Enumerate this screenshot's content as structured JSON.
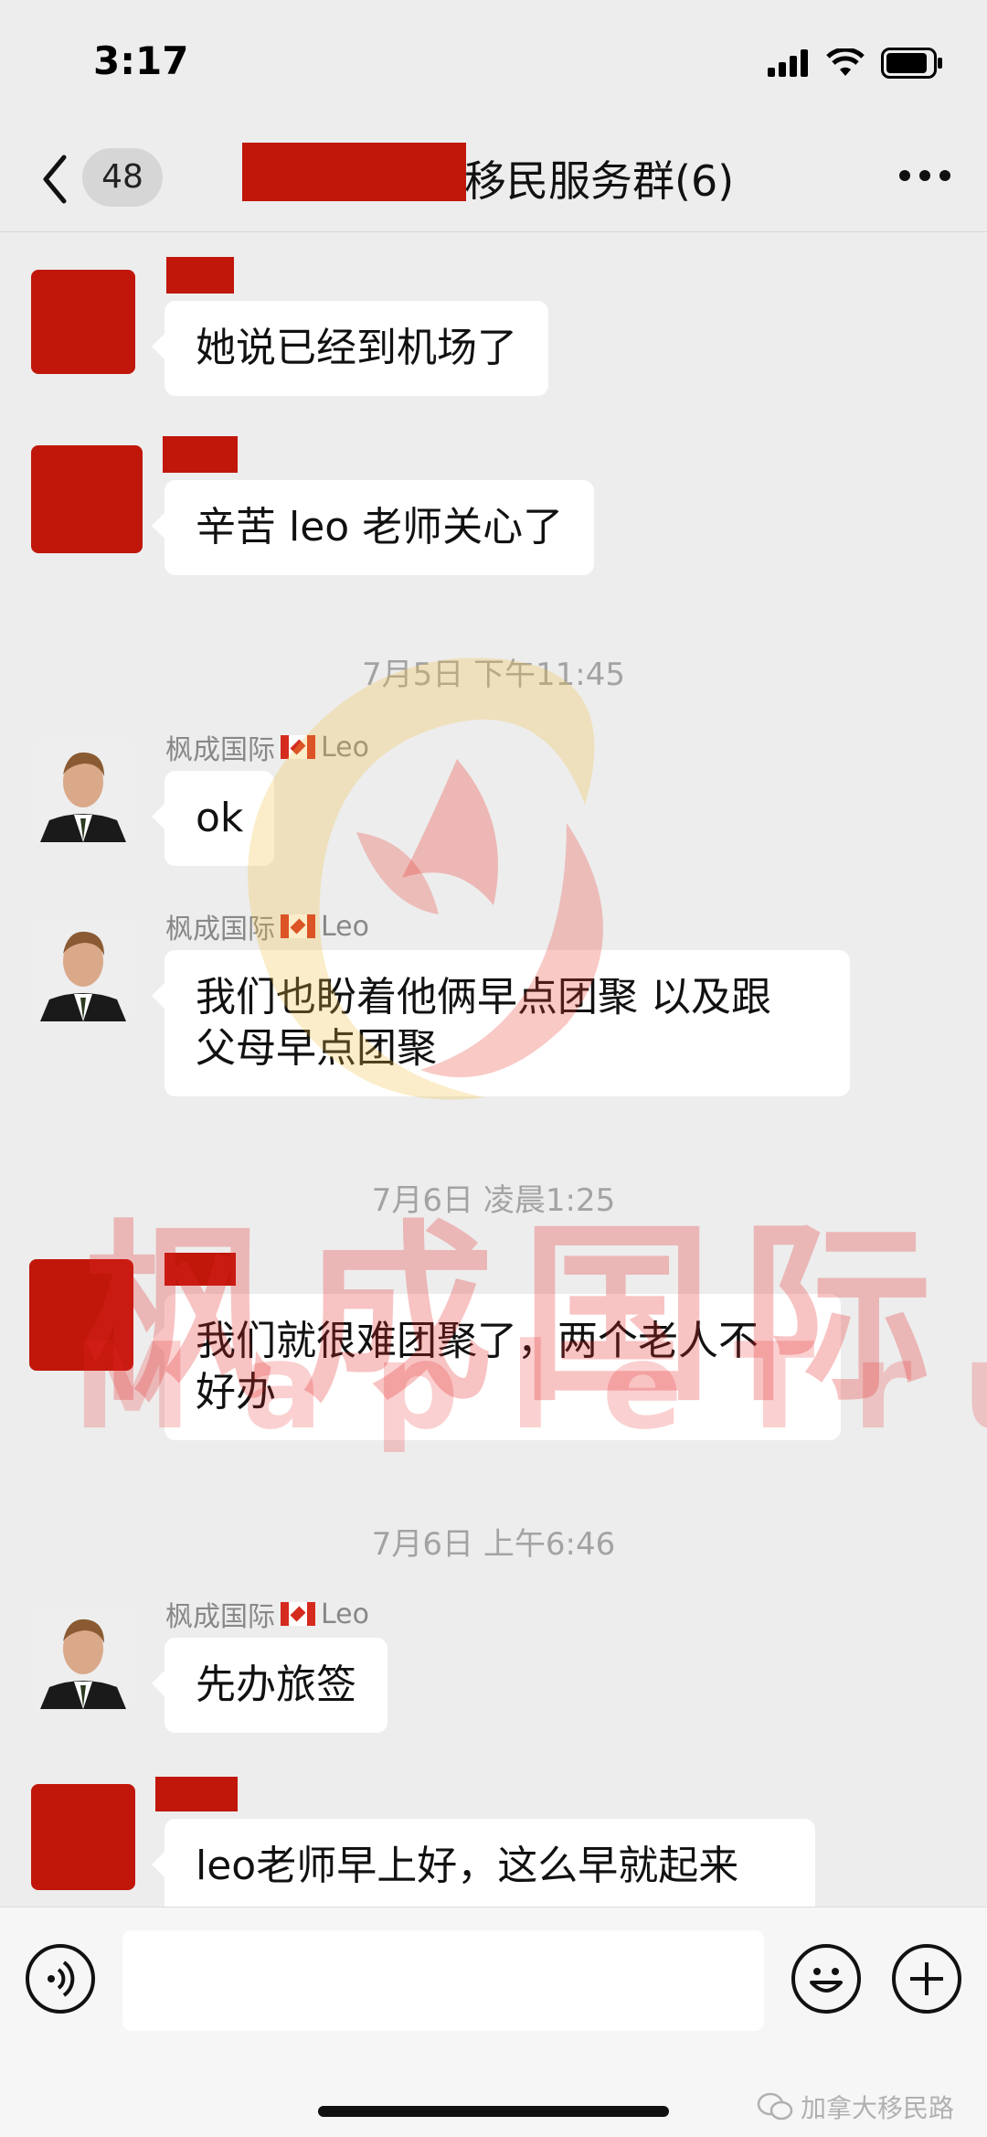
{
  "status_bar": {
    "time": "3:17",
    "battery_level": 0.8
  },
  "nav": {
    "unread_count": "48",
    "title": "移民服务群(6)"
  },
  "messages": [
    {
      "text": "她说已经到机场了"
    },
    {
      "text": "辛苦 leo 老师关心了"
    },
    {
      "timestamp": "7月5日 下午11:45"
    },
    {
      "sender": "枫成国际",
      "sender_suffix": "Leo",
      "text": "ok"
    },
    {
      "sender": "枫成国际",
      "sender_suffix": "Leo",
      "text_line1": "我们也盼着他俩早点团聚 以及跟",
      "text_line2": "父母早点团聚"
    },
    {
      "timestamp": "7月6日 凌晨1:25"
    },
    {
      "text_line1": "我们就很难团聚了，两个老人不",
      "text_line2": "好办"
    },
    {
      "timestamp": "7月6日 上午6:46"
    },
    {
      "sender": "枫成国际",
      "sender_suffix": "Leo",
      "text": "先办旅签"
    },
    {
      "text": "leo老师早上好，这么早就起来"
    }
  ],
  "watermark": {
    "cn": "枫成国际",
    "en": "MapleTrust"
  },
  "footer": {
    "source_label": "加拿大移民路"
  },
  "colors": {
    "background": "#ededed",
    "bubble": "#ffffff",
    "redaction": "#c0170a",
    "timestamp": "#a3a3a3"
  },
  "icons": [
    "back-chevron-icon",
    "more-dots-icon",
    "signal-icon",
    "wifi-icon",
    "battery-icon",
    "voice-icon",
    "emoji-icon",
    "plus-icon",
    "wechat-icon"
  ]
}
